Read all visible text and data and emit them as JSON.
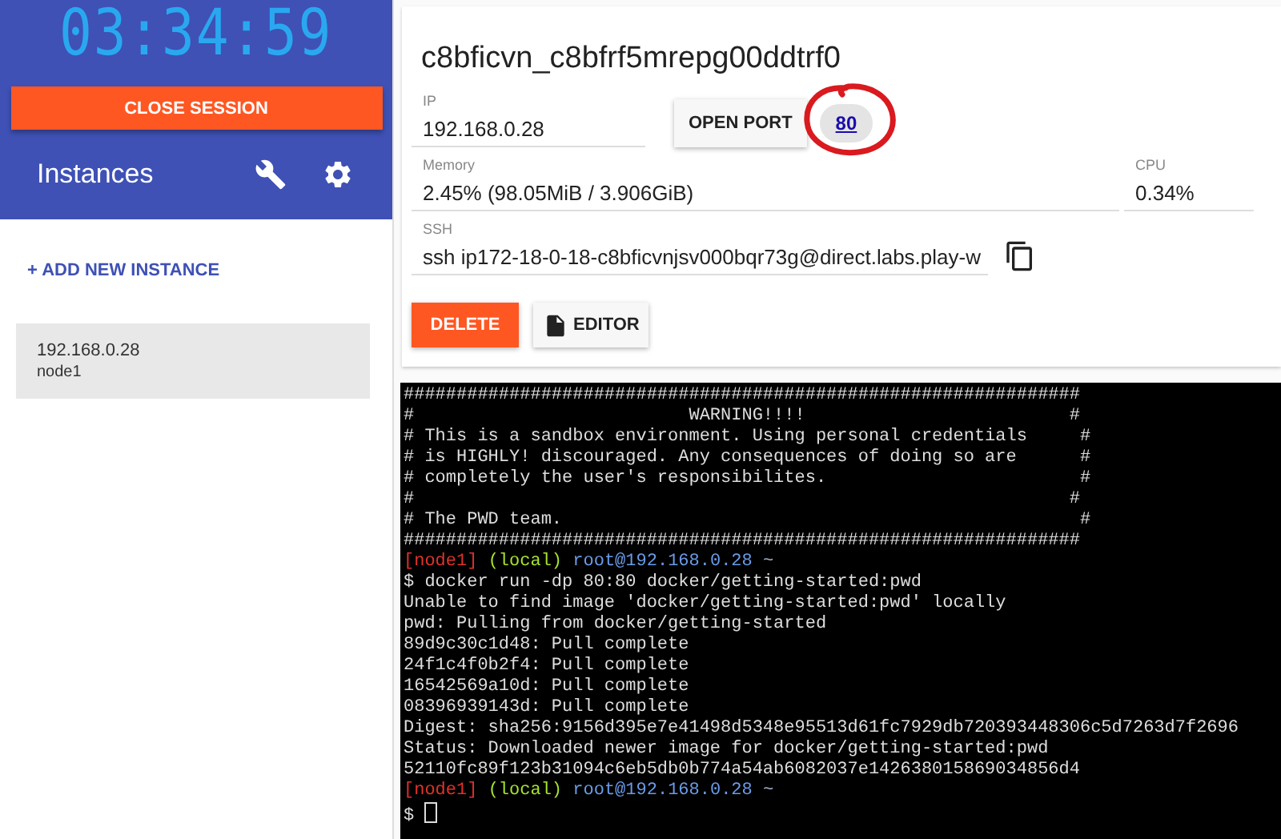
{
  "session": {
    "timer": "03:34:59",
    "close_button": "CLOSE SESSION"
  },
  "sidebar": {
    "title": "Instances",
    "add_button": "+ ADD NEW INSTANCE",
    "instances": [
      {
        "ip": "192.168.0.28",
        "name": "node1",
        "selected": true
      }
    ]
  },
  "instance": {
    "title": "c8bficvn_c8bfrf5mrepg00ddtrf0",
    "ip": {
      "label": "IP",
      "value": "192.168.0.28"
    },
    "open_port_button": "OPEN PORT",
    "ports": [
      {
        "label": "80",
        "circled": true
      }
    ],
    "memory": {
      "label": "Memory",
      "value": "2.45% (98.05MiB / 3.906GiB)"
    },
    "cpu": {
      "label": "CPU",
      "value": "0.34%"
    },
    "ssh": {
      "label": "SSH",
      "value": "ssh ip172-18-0-18-c8bficvnjsv000bqr73g@direct.labs.play-w"
    },
    "delete_button": "DELETE",
    "editor_button": "EDITOR"
  },
  "terminal": {
    "lines": [
      {
        "kind": "text",
        "text": "################################################################"
      },
      {
        "kind": "text",
        "text": "#                          WARNING!!!!                         #"
      },
      {
        "kind": "text",
        "text": "# This is a sandbox environment. Using personal credentials     #"
      },
      {
        "kind": "text",
        "text": "# is HIGHLY! discouraged. Any consequences of doing so are      #"
      },
      {
        "kind": "text",
        "text": "# completely the user's responsibilites.                        #"
      },
      {
        "kind": "text",
        "text": "#                                                              #"
      },
      {
        "kind": "text",
        "text": "# The PWD team.                                                 #"
      },
      {
        "kind": "text",
        "text": "################################################################"
      },
      {
        "kind": "prompt",
        "node": "[node1]",
        "env": "(local)",
        "user": "root@192.168.0.28",
        "dir": "~"
      },
      {
        "kind": "text",
        "text": "$ docker run -dp 80:80 docker/getting-started:pwd"
      },
      {
        "kind": "text",
        "text": "Unable to find image 'docker/getting-started:pwd' locally"
      },
      {
        "kind": "text",
        "text": "pwd: Pulling from docker/getting-started"
      },
      {
        "kind": "text",
        "text": "89d9c30c1d48: Pull complete"
      },
      {
        "kind": "text",
        "text": "24f1c4f0b2f4: Pull complete"
      },
      {
        "kind": "text",
        "text": "16542569a10d: Pull complete"
      },
      {
        "kind": "text",
        "text": "08396939143d: Pull complete"
      },
      {
        "kind": "text",
        "text": "Digest: sha256:9156d395e7e41498d5348e95513d61fc7929db720393448306c5d7263d7f2696"
      },
      {
        "kind": "text",
        "text": "Status: Downloaded newer image for docker/getting-started:pwd"
      },
      {
        "kind": "text",
        "text": "52110fc89f123b31094c6eb5db0b774a54ab6082037e142638015869034856d4"
      },
      {
        "kind": "prompt",
        "node": "[node1]",
        "env": "(local)",
        "user": "root@192.168.0.28",
        "dir": "~"
      },
      {
        "kind": "input",
        "text": "$"
      }
    ]
  }
}
